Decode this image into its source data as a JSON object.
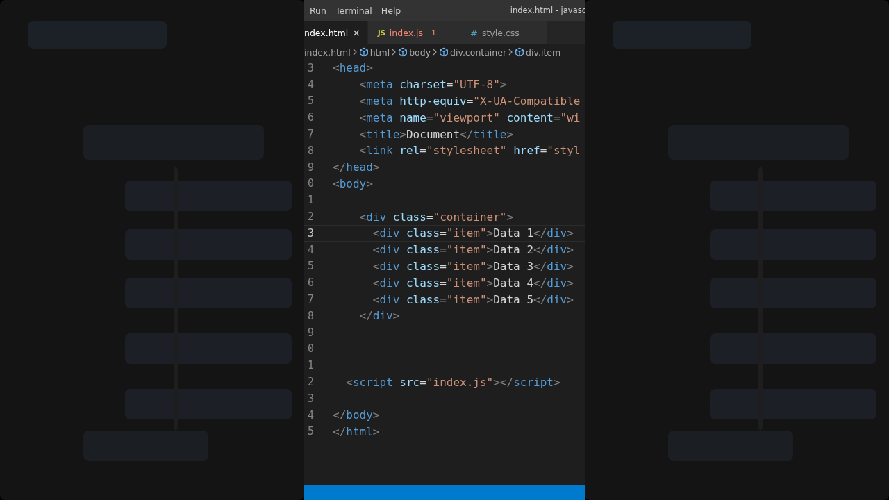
{
  "menu": [
    "Run",
    "Terminal",
    "Help"
  ],
  "window": {
    "title": "index.html - javasc"
  },
  "tabs": [
    {
      "label": "ndex.html",
      "kind": "html",
      "selected": true,
      "close": "×"
    },
    {
      "label": "index.js",
      "kind": "js",
      "selected": false,
      "icon": "JS",
      "badge": "1"
    },
    {
      "label": "style.css",
      "kind": "css",
      "selected": false,
      "icon": "#"
    }
  ],
  "breadcrumb": [
    "index.html",
    "html",
    "body",
    "div.container",
    "div.item"
  ],
  "editor": {
    "lines": [
      {
        "number": "3",
        "tokens": [
          {
            "kind": "punct",
            "text": "<"
          },
          {
            "kind": "tag",
            "text": "head"
          },
          {
            "kind": "punct",
            "text": ">"
          }
        ]
      },
      {
        "number": "4",
        "tokens": [
          {
            "kind": "punct",
            "text": "    <"
          },
          {
            "kind": "tag",
            "text": "meta "
          },
          {
            "kind": "attr",
            "text": "charset"
          },
          {
            "kind": "plain",
            "text": "="
          },
          {
            "kind": "string",
            "text": "\"UTF-8\""
          },
          {
            "kind": "punct",
            "text": ">"
          }
        ]
      },
      {
        "number": "5",
        "tokens": [
          {
            "kind": "punct",
            "text": "    <"
          },
          {
            "kind": "tag",
            "text": "meta "
          },
          {
            "kind": "attr",
            "text": "http-equiv"
          },
          {
            "kind": "plain",
            "text": "="
          },
          {
            "kind": "string",
            "text": "\"X-UA-Compatible"
          }
        ]
      },
      {
        "number": "6",
        "tokens": [
          {
            "kind": "punct",
            "text": "    <"
          },
          {
            "kind": "tag",
            "text": "meta "
          },
          {
            "kind": "attr",
            "text": "name"
          },
          {
            "kind": "plain",
            "text": "="
          },
          {
            "kind": "string",
            "text": "\"viewport\" "
          },
          {
            "kind": "attr",
            "text": "content"
          },
          {
            "kind": "plain",
            "text": "="
          },
          {
            "kind": "string",
            "text": "\"wi"
          }
        ]
      },
      {
        "number": "7",
        "tokens": [
          {
            "kind": "punct",
            "text": "    <"
          },
          {
            "kind": "tag",
            "text": "title"
          },
          {
            "kind": "punct",
            "text": ">"
          },
          {
            "kind": "plain",
            "text": "Document"
          },
          {
            "kind": "punct",
            "text": "</"
          },
          {
            "kind": "tag",
            "text": "title"
          },
          {
            "kind": "punct",
            "text": ">"
          }
        ]
      },
      {
        "number": "8",
        "tokens": [
          {
            "kind": "punct",
            "text": "    <"
          },
          {
            "kind": "tag",
            "text": "link "
          },
          {
            "kind": "attr",
            "text": "rel"
          },
          {
            "kind": "plain",
            "text": "="
          },
          {
            "kind": "string",
            "text": "\"stylesheet\" "
          },
          {
            "kind": "attr",
            "text": "href"
          },
          {
            "kind": "plain",
            "text": "="
          },
          {
            "kind": "string",
            "text": "\"styl"
          }
        ]
      },
      {
        "number": "9",
        "tokens": [
          {
            "kind": "punct",
            "text": "</"
          },
          {
            "kind": "tag",
            "text": "head"
          },
          {
            "kind": "punct",
            "text": ">"
          }
        ]
      },
      {
        "number": "0",
        "tokens": [
          {
            "kind": "punct",
            "text": "<"
          },
          {
            "kind": "tag",
            "text": "body"
          },
          {
            "kind": "punct",
            "text": ">"
          }
        ]
      },
      {
        "number": "1"
      },
      {
        "number": "2",
        "tokens": [
          {
            "kind": "punct",
            "text": "    <"
          },
          {
            "kind": "tag",
            "text": "div "
          },
          {
            "kind": "attr",
            "text": "class"
          },
          {
            "kind": "plain",
            "text": "="
          },
          {
            "kind": "string",
            "text": "\"container\""
          },
          {
            "kind": "punct",
            "text": ">"
          }
        ]
      },
      {
        "number": "3",
        "current": true,
        "tokens": [
          {
            "kind": "punct",
            "text": "      <"
          },
          {
            "kind": "tag",
            "text": "div "
          },
          {
            "kind": "attr",
            "text": "class"
          },
          {
            "kind": "plain",
            "text": "="
          },
          {
            "kind": "string",
            "text": "\"item\""
          },
          {
            "kind": "punct",
            "text": ">"
          },
          {
            "kind": "plain",
            "text": "Data 1"
          },
          {
            "kind": "punct",
            "text": "</"
          },
          {
            "kind": "tag",
            "text": "div"
          },
          {
            "kind": "punct",
            "text": ">"
          }
        ]
      },
      {
        "number": "4",
        "tokens": [
          {
            "kind": "punct",
            "text": "      <"
          },
          {
            "kind": "tag",
            "text": "div "
          },
          {
            "kind": "attr",
            "text": "class"
          },
          {
            "kind": "plain",
            "text": "="
          },
          {
            "kind": "string",
            "text": "\"item\""
          },
          {
            "kind": "punct",
            "text": ">"
          },
          {
            "kind": "plain",
            "text": "Data 2"
          },
          {
            "kind": "punct",
            "text": "</"
          },
          {
            "kind": "tag",
            "text": "div"
          },
          {
            "kind": "punct",
            "text": ">"
          }
        ]
      },
      {
        "number": "5",
        "tokens": [
          {
            "kind": "punct",
            "text": "      <"
          },
          {
            "kind": "tag",
            "text": "div "
          },
          {
            "kind": "attr",
            "text": "class"
          },
          {
            "kind": "plain",
            "text": "="
          },
          {
            "kind": "string",
            "text": "\"item\""
          },
          {
            "kind": "punct",
            "text": ">"
          },
          {
            "kind": "plain",
            "text": "Data 3"
          },
          {
            "kind": "punct",
            "text": "</"
          },
          {
            "kind": "tag",
            "text": "div"
          },
          {
            "kind": "punct",
            "text": ">"
          }
        ]
      },
      {
        "number": "6",
        "tokens": [
          {
            "kind": "punct",
            "text": "      <"
          },
          {
            "kind": "tag",
            "text": "div "
          },
          {
            "kind": "attr",
            "text": "class"
          },
          {
            "kind": "plain",
            "text": "="
          },
          {
            "kind": "string",
            "text": "\"item\""
          },
          {
            "kind": "punct",
            "text": ">"
          },
          {
            "kind": "plain",
            "text": "Data 4"
          },
          {
            "kind": "punct",
            "text": "</"
          },
          {
            "kind": "tag",
            "text": "div"
          },
          {
            "kind": "punct",
            "text": ">"
          }
        ]
      },
      {
        "number": "7",
        "tokens": [
          {
            "kind": "punct",
            "text": "      <"
          },
          {
            "kind": "tag",
            "text": "div "
          },
          {
            "kind": "attr",
            "text": "class"
          },
          {
            "kind": "plain",
            "text": "="
          },
          {
            "kind": "string",
            "text": "\"item\""
          },
          {
            "kind": "punct",
            "text": ">"
          },
          {
            "kind": "plain",
            "text": "Data 5"
          },
          {
            "kind": "punct",
            "text": "</"
          },
          {
            "kind": "tag",
            "text": "div"
          },
          {
            "kind": "punct",
            "text": ">"
          }
        ]
      },
      {
        "number": "8",
        "tokens": [
          {
            "kind": "punct",
            "text": "    </"
          },
          {
            "kind": "tag",
            "text": "div"
          },
          {
            "kind": "punct",
            "text": ">"
          }
        ]
      },
      {
        "number": "9"
      },
      {
        "number": "0"
      },
      {
        "number": "1"
      },
      {
        "number": "2",
        "tokens": [
          {
            "kind": "punct",
            "text": "  <"
          },
          {
            "kind": "tag",
            "text": "script "
          },
          {
            "kind": "attr",
            "text": "src"
          },
          {
            "kind": "plain",
            "text": "="
          },
          {
            "kind": "string",
            "text": "\""
          },
          {
            "kind": "link",
            "text": "index.js"
          },
          {
            "kind": "string",
            "text": "\""
          },
          {
            "kind": "punct",
            "text": "></"
          },
          {
            "kind": "tag",
            "text": "script"
          },
          {
            "kind": "punct",
            "text": ">"
          }
        ]
      },
      {
        "number": "3"
      },
      {
        "number": "4",
        "tokens": [
          {
            "kind": "punct",
            "text": "</"
          },
          {
            "kind": "tag",
            "text": "body"
          },
          {
            "kind": "punct",
            "text": ">"
          }
        ]
      },
      {
        "number": "5",
        "tokens": [
          {
            "kind": "punct",
            "text": "</"
          },
          {
            "kind": "tag",
            "text": "html"
          },
          {
            "kind": "punct",
            "text": ">"
          }
        ]
      }
    ]
  },
  "background": {
    "kind": "picture"
  }
}
